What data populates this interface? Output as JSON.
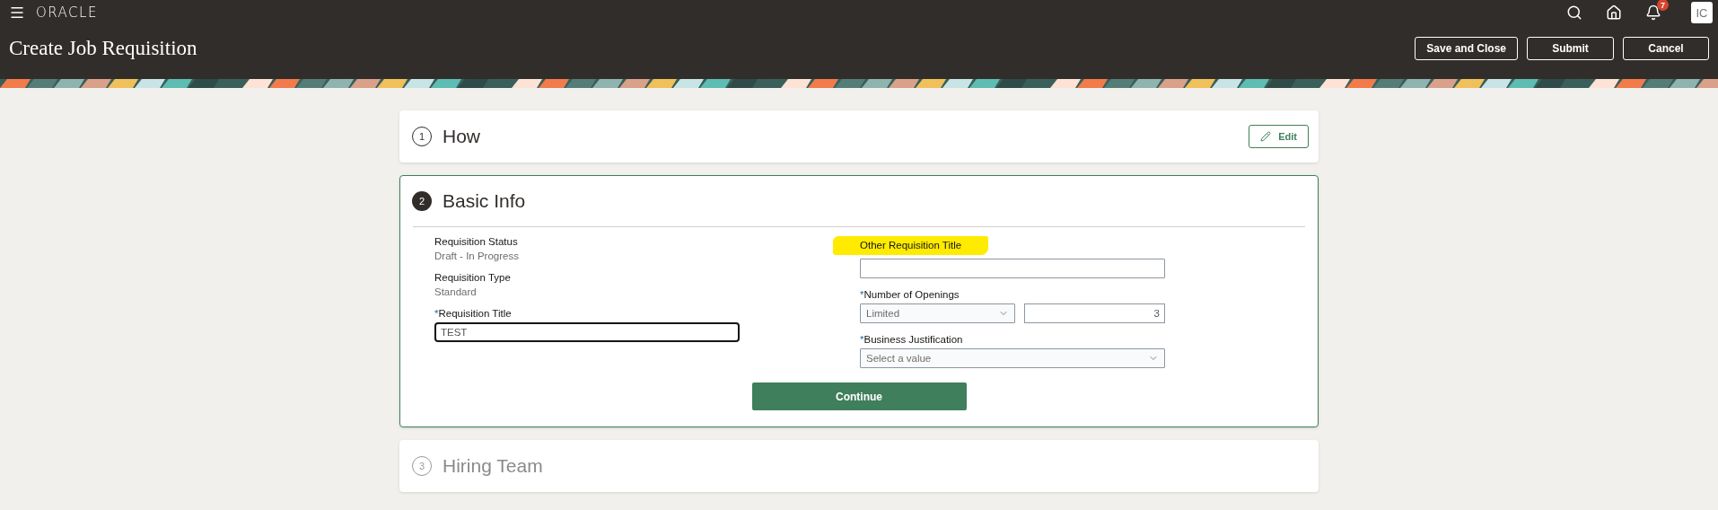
{
  "header": {
    "logo": "ORACLE",
    "notifications": "7",
    "avatar": "IC",
    "title": "Create Job Requisition",
    "actions": [
      "Save and Close",
      "Submit",
      "Cancel"
    ]
  },
  "steps": [
    {
      "number": "1",
      "title": "How",
      "selected": false,
      "disabled": false,
      "action": "Edit"
    },
    {
      "number": "2",
      "title": "Basic Info",
      "selected": true,
      "disabled": false
    },
    {
      "number": "3",
      "title": "Hiring Team",
      "selected": false,
      "disabled": true
    }
  ],
  "basic_info": {
    "left": [
      {
        "kind": "readonly",
        "label": "Requisition Status",
        "value": "Draft - In Progress"
      },
      {
        "kind": "readonly",
        "label": "Requisition Type",
        "value": "Standard"
      },
      {
        "kind": "text",
        "label": "Requisition Title",
        "marker": "*",
        "highlighted": false,
        "focused": true,
        "value": "TEST"
      }
    ],
    "right": [
      {
        "kind": "text",
        "label": "Other Requisition Title",
        "highlighted": true,
        "focused": false
      },
      {
        "kind": "select_number",
        "label": "Number of Openings",
        "marker": "*",
        "highlighted": false,
        "select_value": "Limited",
        "number_value": "3"
      },
      {
        "kind": "select",
        "label": "Business Justification",
        "marker": "*",
        "highlighted": false,
        "placeholder": "Select a value"
      }
    ],
    "continue": "Continue"
  }
}
